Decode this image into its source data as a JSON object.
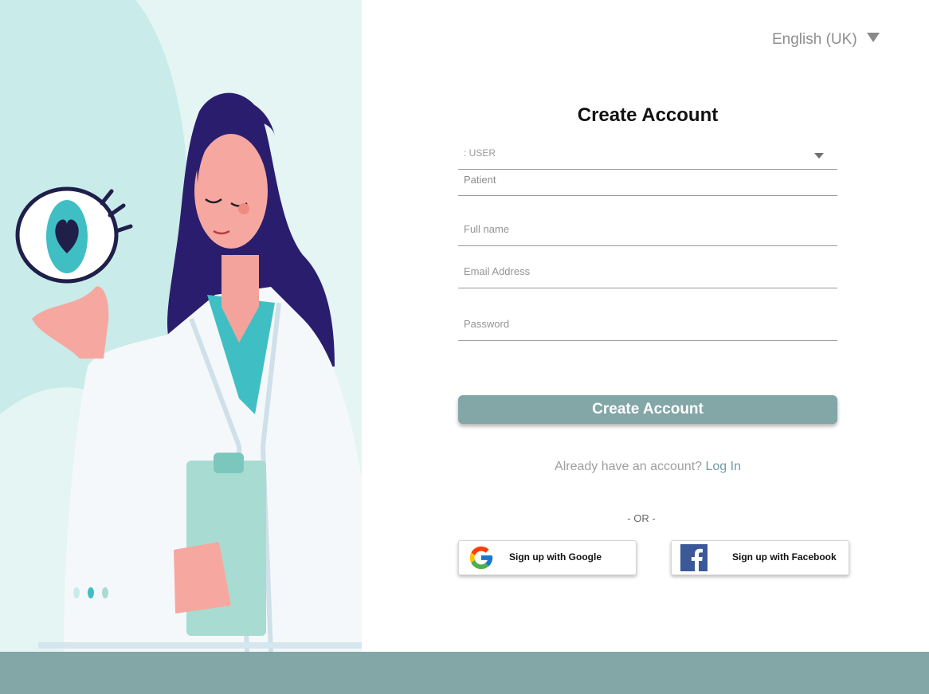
{
  "language": {
    "selected": "English (UK)"
  },
  "form": {
    "title": "Create Account",
    "role_label": ": USER",
    "role_value": "Patient",
    "fields": {
      "full_name_placeholder": "Full name",
      "email_placeholder": "Email Address",
      "password_placeholder": "Password"
    },
    "submit_label": "Create Account",
    "login_prompt": "Already have an account?",
    "login_link": "Log In",
    "or_divider": "- OR -"
  },
  "social": {
    "google_label": "Sign up with Google",
    "facebook_label": "Sign up with Facebook"
  },
  "colors": {
    "accent": "#83a6a7",
    "panel_bg": "#c9ebe9",
    "link": "#6f9ea3"
  },
  "icons": {
    "language_dropdown": "caret-down-icon",
    "role_dropdown": "caret-down-icon",
    "google": "google-logo-icon",
    "facebook": "facebook-logo-icon"
  }
}
